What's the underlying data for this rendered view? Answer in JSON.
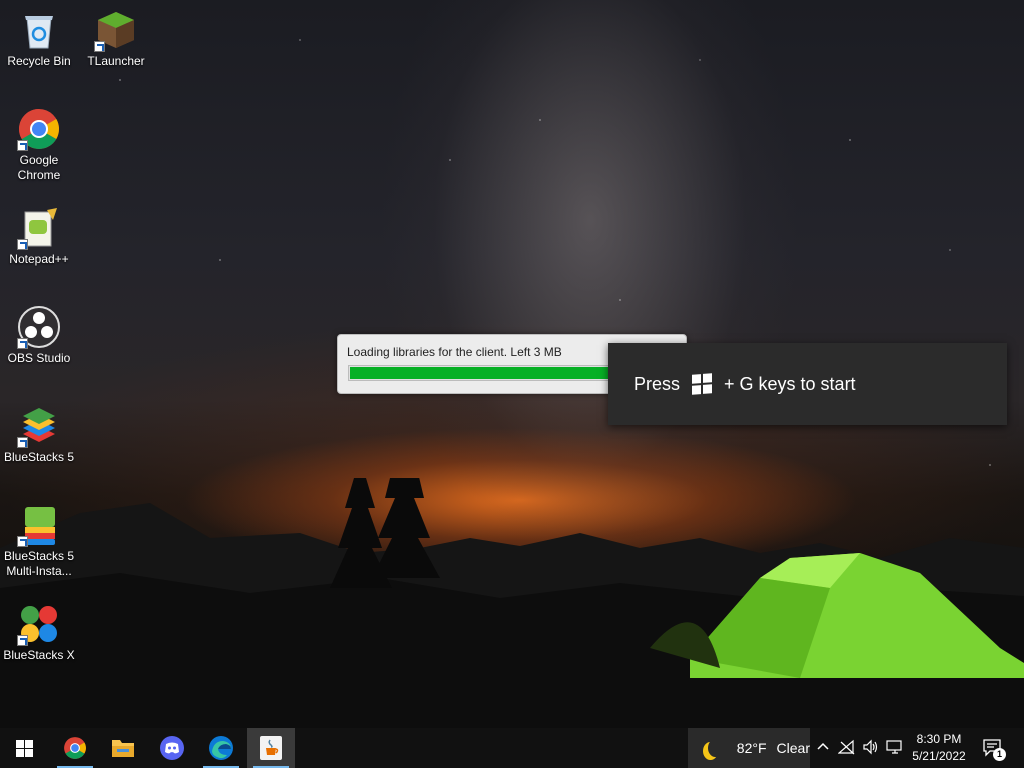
{
  "desktop": {
    "icons": [
      {
        "label": "Recycle Bin"
      },
      {
        "label": "TLauncher"
      },
      {
        "label": "Google Chrome"
      },
      {
        "label": "Notepad++"
      },
      {
        "label": "OBS Studio"
      },
      {
        "label": "BlueStacks 5"
      },
      {
        "label": "BlueStacks 5 Multi-Insta..."
      },
      {
        "label": "BlueStacks X"
      }
    ]
  },
  "loading_dialog": {
    "message": "Loading libraries for the client. Left 3 MB",
    "progress_percent": 85,
    "progress_color": "#06b025"
  },
  "gamebar_toast": {
    "text_before": "Press",
    "text_after": "+ G keys to start",
    "icon": "windows-logo-icon"
  },
  "taskbar": {
    "apps": [
      {
        "name": "Start",
        "icon": "windows-start-icon"
      },
      {
        "name": "Google Chrome",
        "icon": "chrome-icon"
      },
      {
        "name": "File Explorer",
        "icon": "folder-icon"
      },
      {
        "name": "Discord",
        "icon": "discord-icon"
      },
      {
        "name": "Microsoft Edge",
        "icon": "edge-icon"
      },
      {
        "name": "Java",
        "icon": "java-icon",
        "active": true
      }
    ],
    "weather": {
      "temp": "82°F",
      "condition": "Clear",
      "icon": "moon-icon"
    },
    "clock": {
      "time": "8:30 PM",
      "date": "5/21/2022"
    },
    "notifications_count": "1"
  }
}
